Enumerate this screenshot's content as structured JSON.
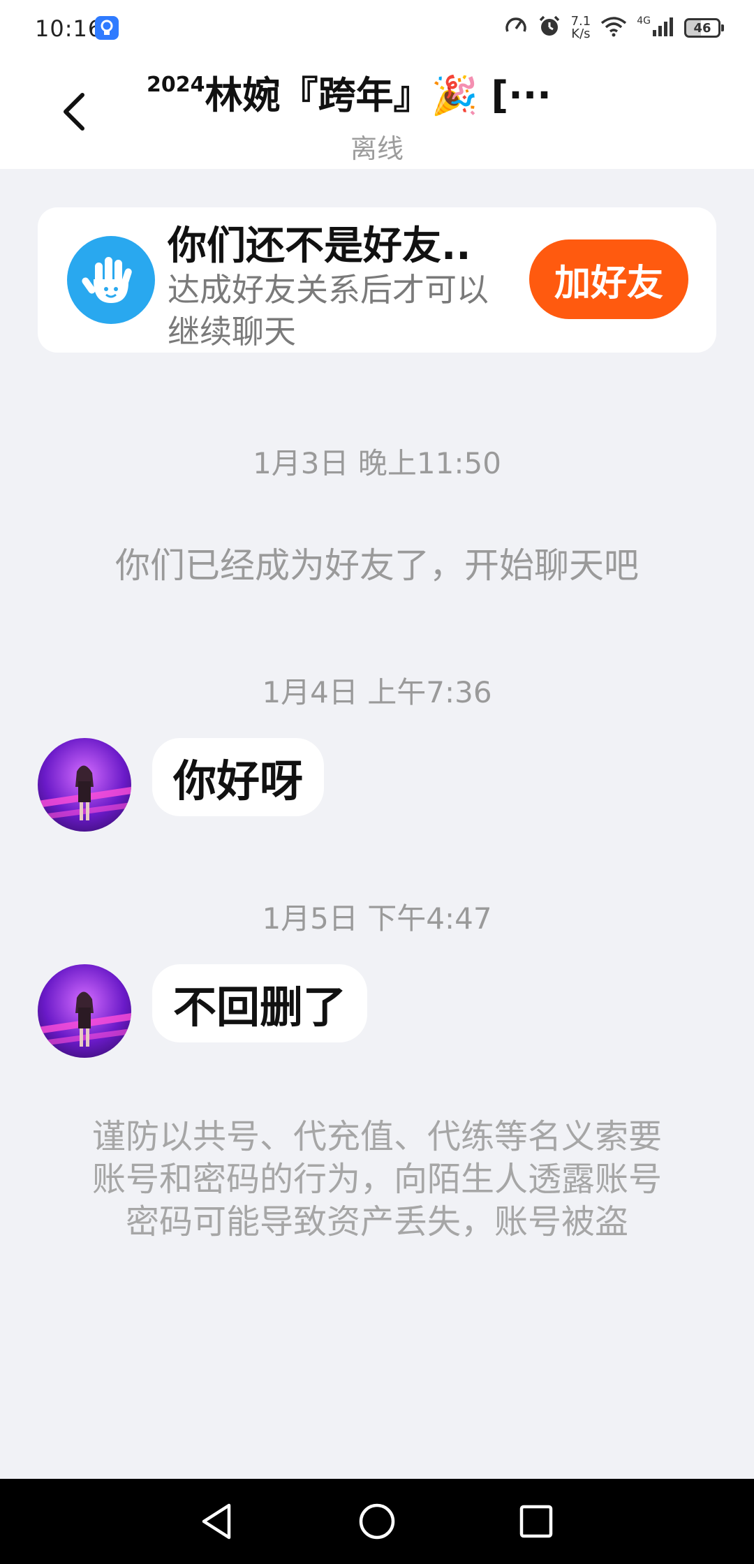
{
  "status_bar": {
    "time": "10:16",
    "net_speed_value": "7.1",
    "net_speed_unit": "K/s",
    "network": "4G",
    "battery": "46"
  },
  "header": {
    "title_prefix": "2024",
    "title": "林婉『跨年』🎉 [",
    "more_label": "···",
    "status": "离线"
  },
  "friend_banner": {
    "title": "你们还不是好友..",
    "description": "达成好友关系后才可以继续聊天",
    "add_button_label": "加好友",
    "icon_color": "#29a8ef",
    "button_color": "#ff5a0f"
  },
  "chat": {
    "items": [
      {
        "timestamp": "1月3日 晚上11:50"
      },
      {
        "system": "你们已经成为好友了，开始聊天吧"
      },
      {
        "timestamp": "1月4日 上午7:36"
      },
      {
        "message": "你好呀"
      },
      {
        "timestamp": "1月5日 下午4:47"
      },
      {
        "message": "不回删了"
      }
    ],
    "warning": "谨防以共号、代充值、代练等名义索要账号和密码的行为，向陌生人透露账号密码可能导致资产丢失，账号被盗"
  },
  "icons": {
    "back": "chevron-left-icon",
    "banner": "hand-wave-icon",
    "nav_back": "triangle-back-icon",
    "nav_home": "circle-home-icon",
    "nav_recent": "square-recent-icon"
  }
}
